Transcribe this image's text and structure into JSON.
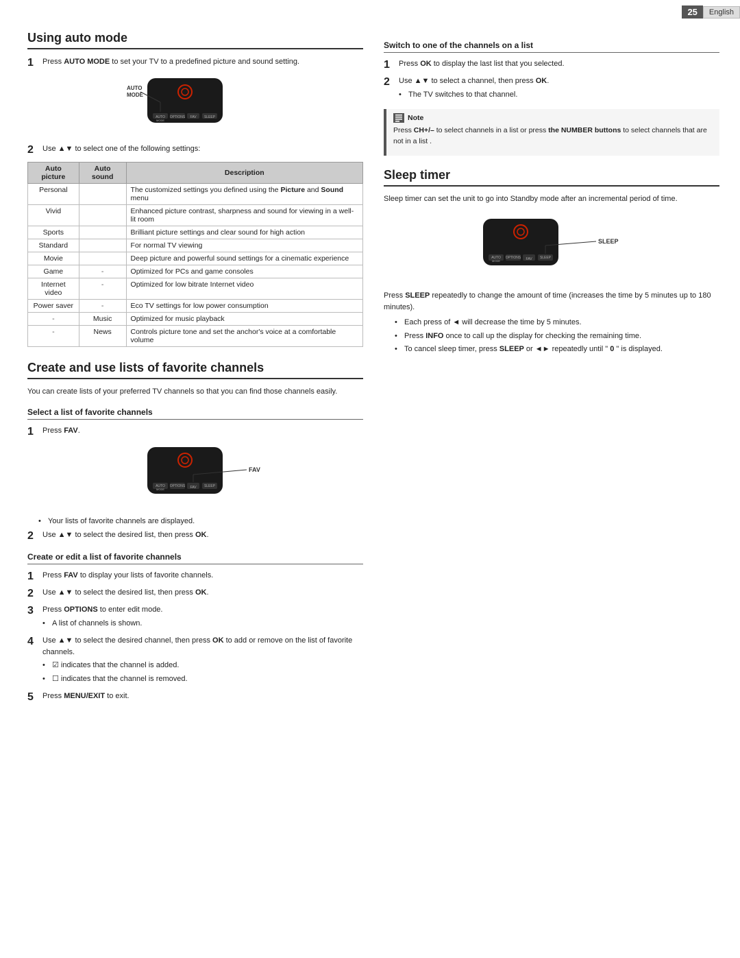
{
  "page": {
    "number": "25",
    "language": "English"
  },
  "left_column": {
    "section1": {
      "title": "Using auto mode",
      "steps": [
        {
          "num": "1",
          "text": "Press AUTO MODE to set your TV to a predefined picture and sound setting."
        },
        {
          "num": "2",
          "text": "Use ▲▼ to select one of the following settings:"
        }
      ],
      "table": {
        "headers": [
          "Auto picture",
          "Auto sound",
          "Description"
        ],
        "rows": [
          {
            "auto_picture": "Personal",
            "auto_sound": "",
            "description": "The customized settings you defined using the Picture and Sound menu"
          },
          {
            "auto_picture": "Vivid",
            "auto_sound": "",
            "description": "Enhanced picture contrast, sharpness and sound for viewing in a well-lit room"
          },
          {
            "auto_picture": "Sports",
            "auto_sound": "",
            "description": "Brilliant picture settings and clear sound for high action"
          },
          {
            "auto_picture": "Standard",
            "auto_sound": "",
            "description": "For normal TV viewing"
          },
          {
            "auto_picture": "Movie",
            "auto_sound": "",
            "description": "Deep picture and powerful sound settings for a cinematic experience"
          },
          {
            "auto_picture": "Game",
            "auto_sound": "-",
            "description": "Optimized for PCs and game consoles"
          },
          {
            "auto_picture": "Internet video",
            "auto_sound": "-",
            "description": "Optimized for low bitrate Internet video"
          },
          {
            "auto_picture": "Power saver",
            "auto_sound": "-",
            "description": "Eco TV settings for low power consumption"
          },
          {
            "auto_picture": "-",
            "auto_sound": "Music",
            "description": "Optimized for music playback"
          },
          {
            "auto_picture": "-",
            "auto_sound": "News",
            "description": "Controls picture tone and set the anchor's voice at a comfortable volume"
          }
        ]
      }
    },
    "section2": {
      "title": "Create and use lists of favorite channels",
      "description": "You can create lists of your preferred TV channels so that you can find those channels easily.",
      "subsection1": {
        "title": "Select a list of favorite channels",
        "steps": [
          {
            "num": "1",
            "text": "Press FAV."
          },
          {
            "num": "2",
            "text": "Use ▲▼ to select the desired list, then press OK."
          }
        ],
        "bullet": "Your lists of favorite channels are displayed."
      },
      "subsection2": {
        "title": "Create or edit a list of favorite channels",
        "steps": [
          {
            "num": "1",
            "text": "Press FAV to display your lists of favorite channels."
          },
          {
            "num": "2",
            "text": "Use ▲▼ to select the desired list, then press OK."
          },
          {
            "num": "3",
            "text": "Press OPTIONS to enter edit mode."
          },
          {
            "num": "4",
            "text": "Use ▲▼ to select the desired channel, then press OK to add or remove on the list of favorite channels."
          },
          {
            "num": "5",
            "text": "Press MENU/EXIT to exit."
          }
        ],
        "step3_bullet": "A list of channels is shown.",
        "step4_bullets": [
          "☑ indicates that the channel is added.",
          "☐ indicates that the channel is removed."
        ]
      }
    }
  },
  "right_column": {
    "section1": {
      "title": "Switch to one of the channels on a list",
      "steps": [
        {
          "num": "1",
          "text": "Press OK to display the last list that you selected."
        },
        {
          "num": "2",
          "text": "Use ▲▼ to select a channel, then press OK."
        }
      ],
      "bullet": "The TV switches to that channel.",
      "note": {
        "label": "Note",
        "text": "Press CH+/– to select channels in a list or press the NUMBER buttons to select channels that are not in a list."
      }
    },
    "section2": {
      "title": "Sleep timer",
      "intro": "Sleep timer can set the unit to go into Standby mode after an incremental period of time.",
      "remote_label": "SLEEP",
      "steps_text": "Press SLEEP repeatedly to change the amount of time (increases the time by 5 minutes up to 180 minutes).",
      "bullets": [
        "Each press of ◄ will decrease the time by 5 minutes.",
        "Press INFO once to call up the display for checking the remaining time.",
        "To cancel sleep timer, press SLEEP or ◄► repeatedly until \" 0 \" is displayed."
      ]
    }
  },
  "remote": {
    "buttons": [
      "AUTO MODE",
      "OPTIONS",
      "FAV",
      "SLEEP"
    ],
    "fav_label": "FAV",
    "sleep_label": "SLEEP",
    "auto_label": "AUTO MODE"
  }
}
